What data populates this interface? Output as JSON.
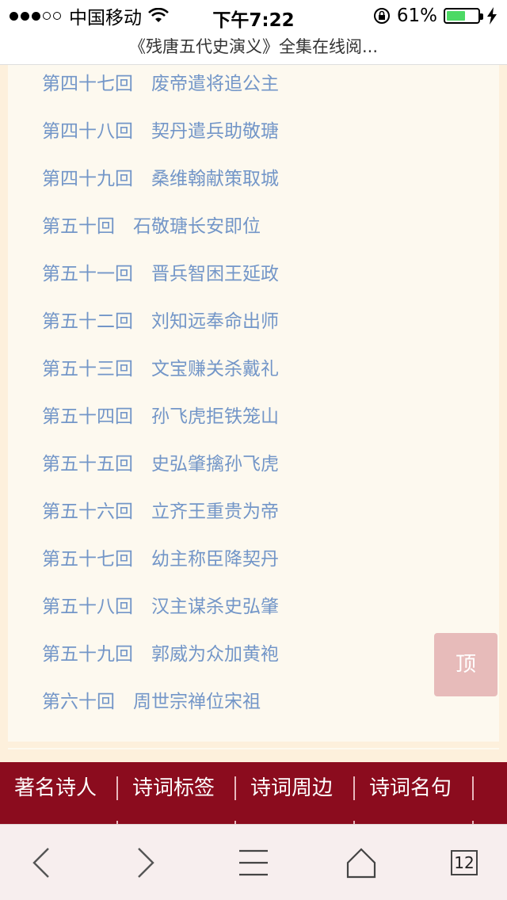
{
  "status_bar": {
    "carrier": "中国移动",
    "time": "下午7:22",
    "battery_percent": "61%",
    "battery_level": 0.61,
    "signal_bars_filled": 3,
    "signal_bars_total": 5
  },
  "page_title": "《残唐五代史演义》全集在线阅...",
  "chapters": [
    "第四十七回　废帝遣将追公主",
    "第四十八回　契丹遣兵助敬瑭",
    "第四十九回　桑维翰献策取城",
    "第五十回　石敬瑭长安即位",
    "第五十一回　晋兵智困王延政",
    "第五十二回　刘知远奉命出师",
    "第五十三回　文宝赚关杀戴礼",
    "第五十四回　孙飞虎拒铁笼山",
    "第五十五回　史弘肇擒孙飞虎",
    "第五十六回　立齐王重贵为帝",
    "第五十七回　幼主称臣降契丹",
    "第五十八回　汉主谋杀史弘肇",
    "第五十九回　郭威为众加黄袍",
    "第六十回　周世宗禅位宋祖"
  ],
  "to_top_label": "顶",
  "category_nav": [
    "著名诗人",
    "诗词标签",
    "诗词周边",
    "诗词名句"
  ],
  "toolbar": {
    "tabs_count": "12",
    "icons": [
      "back-icon",
      "forward-icon",
      "bookmarks-icon",
      "share-icon",
      "tabs-icon"
    ]
  },
  "colors": {
    "link": "#7396c8",
    "nav_red": "#8b0c1e",
    "page_bg": "#fdf0dc",
    "card_bg": "#fdf9ef",
    "battery_green": "#4cd964"
  }
}
